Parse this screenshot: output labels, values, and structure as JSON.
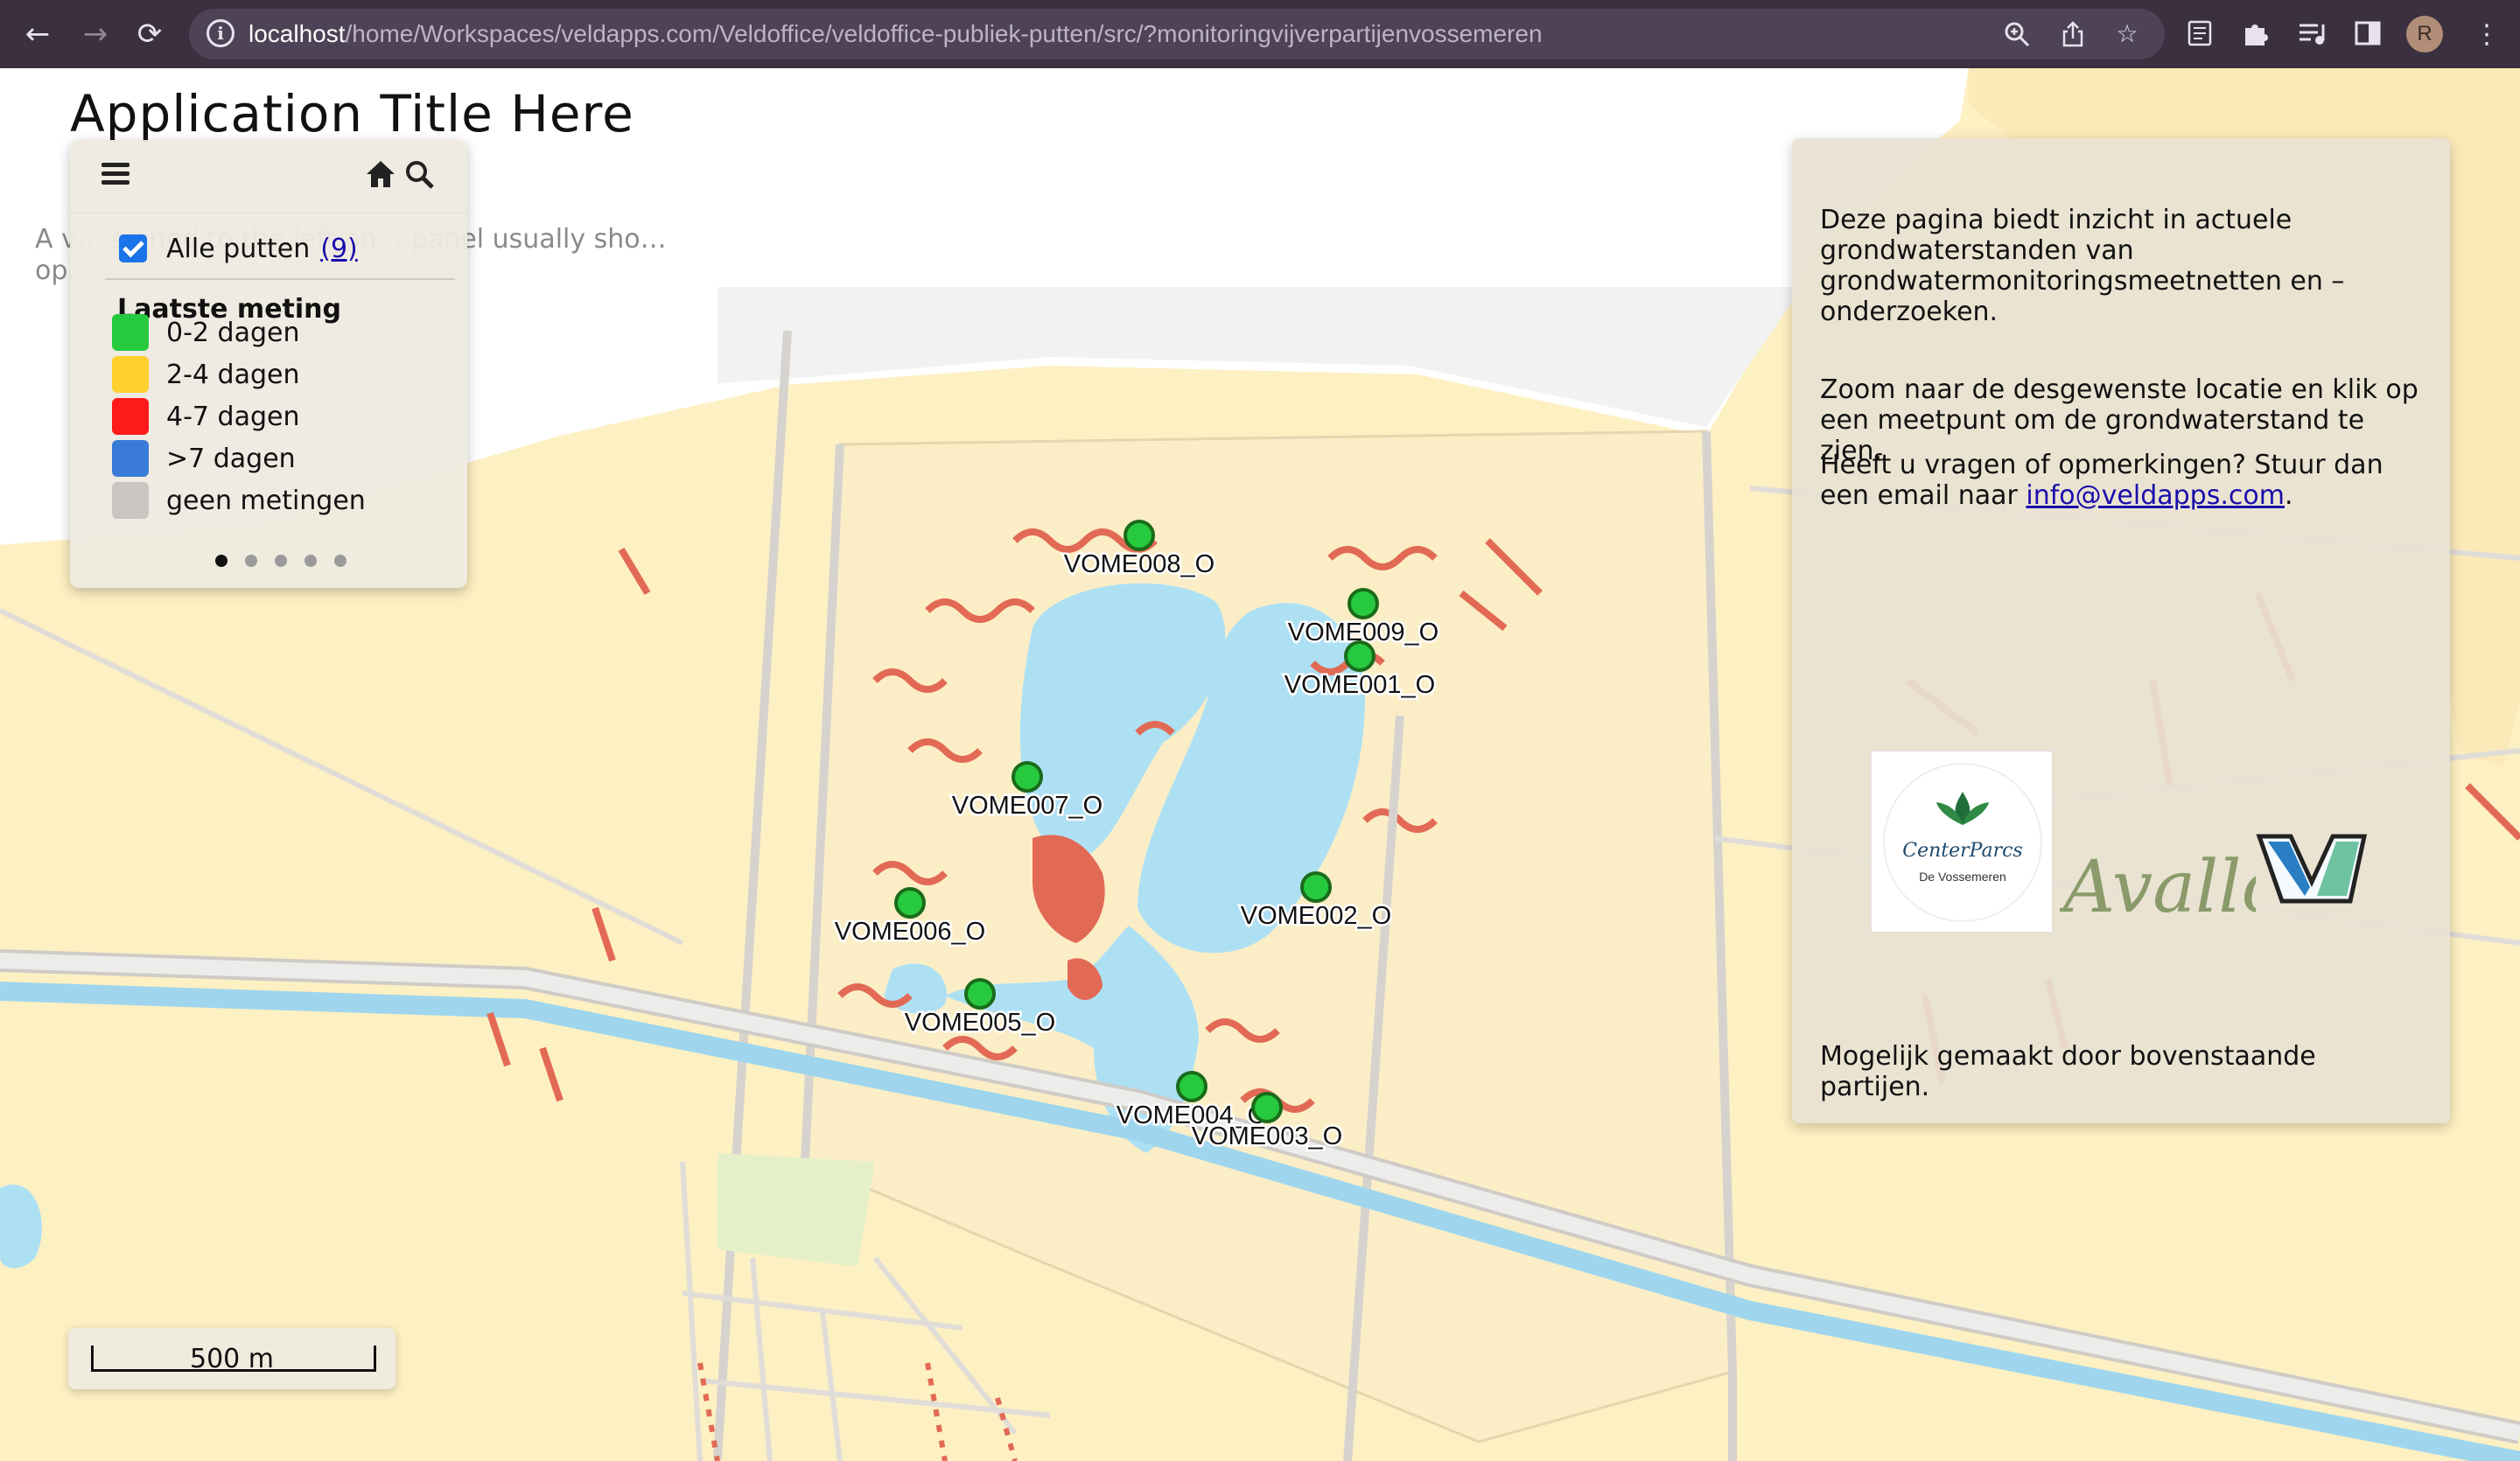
{
  "browser": {
    "url_host": "localhost",
    "url_path": "/home/Workspaces/veldapps.com/Veldoffice/veldoffice-publiek-putten/src/?monitoringvijverpartijenvossemeren",
    "profile_initial": "R"
  },
  "app": {
    "title": "Application Title Here",
    "background_description": "A v… signed to the left an… panel usually sho… op."
  },
  "legend": {
    "all_wells_label": "Alle putten",
    "all_wells_count": "(9)",
    "all_wells_checked": true,
    "section_title": "Laatste meting",
    "items": [
      {
        "label": "0-2 dagen",
        "color": "#27c93f"
      },
      {
        "label": "2-4 dagen",
        "color": "#ffd02e"
      },
      {
        "label": "4-7 dagen",
        "color": "#ff1a1a"
      },
      {
        "label": ">7 dagen",
        "color": "#3b7bd8"
      },
      {
        "label": "geen metingen",
        "color": "#c9c6c2"
      }
    ],
    "page_dots": 5,
    "active_dot": 1
  },
  "wells": [
    {
      "name": "VOME008_O",
      "status": "0-2 dagen"
    },
    {
      "name": "VOME009_O",
      "status": "0-2 dagen"
    },
    {
      "name": "VOME001_O",
      "status": "0-2 dagen"
    },
    {
      "name": "VOME007_O",
      "status": "0-2 dagen"
    },
    {
      "name": "VOME002_O",
      "status": "0-2 dagen"
    },
    {
      "name": "VOME006_O",
      "status": "0-2 dagen"
    },
    {
      "name": "VOME005_O",
      "status": "0-2 dagen"
    },
    {
      "name": "VOME004_O",
      "status": "0-2 dagen"
    },
    {
      "name": "VOME003_O",
      "status": "0-2 dagen"
    }
  ],
  "info": {
    "para1": "Deze pagina biedt inzicht in actuele grondwaterstanden van grondwatermonitoringsmeetnetten en –onderzoeken.",
    "para2": "Zoom naar de desgewenste locatie en klik op een meetpunt om de grondwaterstand te zien.",
    "para3_prefix": "Heeft u vragen of opmerkingen? Stuur dan een email naar ",
    "email": "info@veldapps.com",
    "para3_suffix": ".",
    "footer": "Mogelijk gemaakt door bovenstaande partijen.",
    "partner_cp_name": "CenterParcs",
    "partner_cp_location": "De Vossemeren",
    "partner_avallo": "Avallo"
  },
  "scale": {
    "label": "500 m"
  }
}
